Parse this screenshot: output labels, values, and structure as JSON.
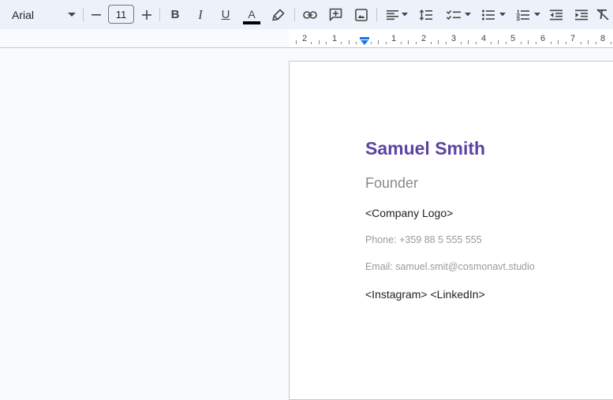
{
  "toolbar": {
    "font_name": "Arial",
    "font_size": "11",
    "minus_glyph": "–",
    "plus_glyph": "+",
    "bold_label": "B",
    "italic_label": "I",
    "underline_label": "U",
    "text_color_label": "A",
    "colors": {
      "text_color_bar": "#000000",
      "accent": "#0b57d0"
    },
    "icons": [
      "chevron-down-icon",
      "minus-icon",
      "plus-icon",
      "bold-icon",
      "italic-icon",
      "underline-icon",
      "text-color-icon",
      "highlighter-icon",
      "link-icon",
      "add-comment-icon",
      "image-icon",
      "align-left-icon",
      "line-spacing-icon",
      "checklist-icon",
      "bulleted-list-icon",
      "numbered-list-icon",
      "decrease-indent-icon",
      "increase-indent-icon",
      "clear-formatting-icon"
    ]
  },
  "ruler": {
    "labels": [
      "2",
      "1",
      "1",
      "2",
      "3",
      "4",
      "5",
      "6",
      "7",
      "8"
    ]
  },
  "document": {
    "name": "Samuel Smith",
    "title": "Founder",
    "company_logo": "<Company Logo>",
    "phone": "Phone: +359 88 5 555 555",
    "email": "Email: samuel.smit@cosmonavt.studio",
    "social": "<Instagram> <LinkedIn>",
    "colors": {
      "name": "#5b44a1",
      "secondary_text": "#9a9a9a"
    }
  }
}
